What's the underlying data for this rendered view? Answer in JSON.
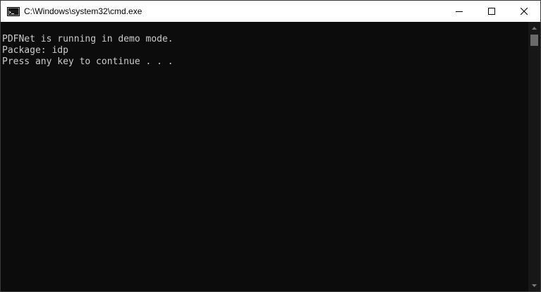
{
  "window": {
    "title": "C:\\Windows\\system32\\cmd.exe"
  },
  "icons": {
    "app": "cmd-icon",
    "minimize": "minimize-icon",
    "maximize": "maximize-icon",
    "close": "close-icon"
  },
  "console": {
    "lines": [
      "PDFNet is running in demo mode.",
      "Package: idp",
      "Press any key to continue . . ."
    ]
  },
  "colors": {
    "background": "#0c0c0c",
    "text": "#cccccc",
    "titlebar": "#ffffff"
  }
}
